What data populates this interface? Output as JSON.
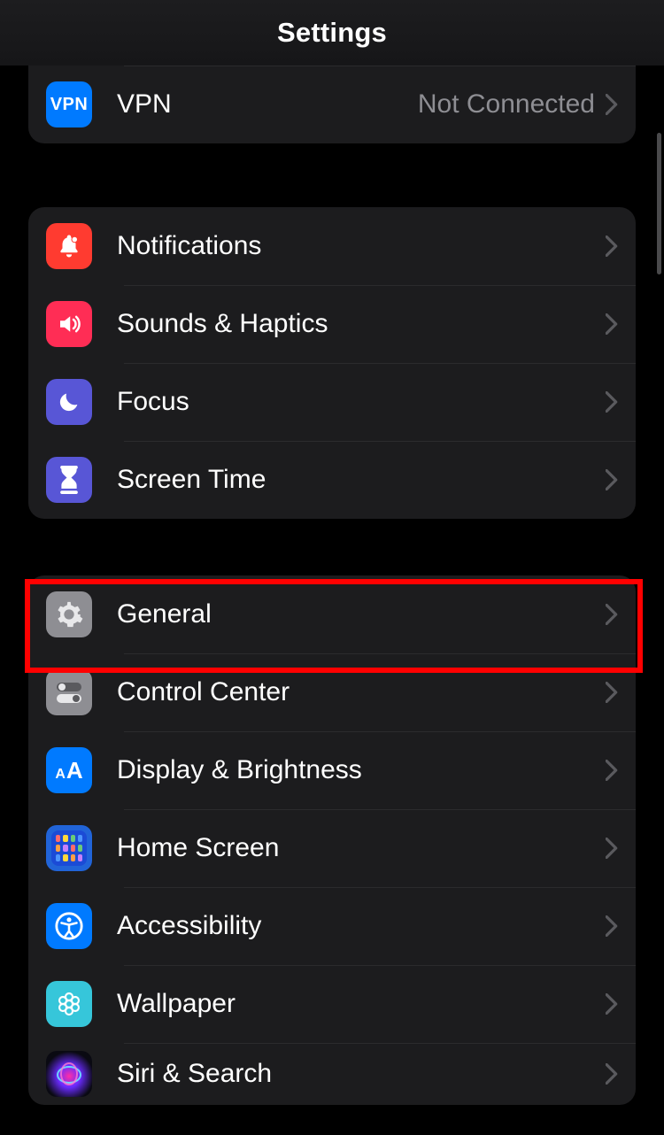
{
  "header": {
    "title": "Settings"
  },
  "group1": {
    "vpn": {
      "label": "VPN",
      "value": "Not Connected",
      "icon_text": "VPN"
    }
  },
  "group2": {
    "notifications": {
      "label": "Notifications"
    },
    "sounds": {
      "label": "Sounds & Haptics"
    },
    "focus": {
      "label": "Focus"
    },
    "screentime": {
      "label": "Screen Time"
    }
  },
  "group3": {
    "general": {
      "label": "General"
    },
    "control_center": {
      "label": "Control Center"
    },
    "display": {
      "label": "Display & Brightness"
    },
    "home_screen": {
      "label": "Home Screen"
    },
    "accessibility": {
      "label": "Accessibility"
    },
    "wallpaper": {
      "label": "Wallpaper"
    },
    "siri": {
      "label": "Siri & Search"
    }
  },
  "highlight": "general"
}
